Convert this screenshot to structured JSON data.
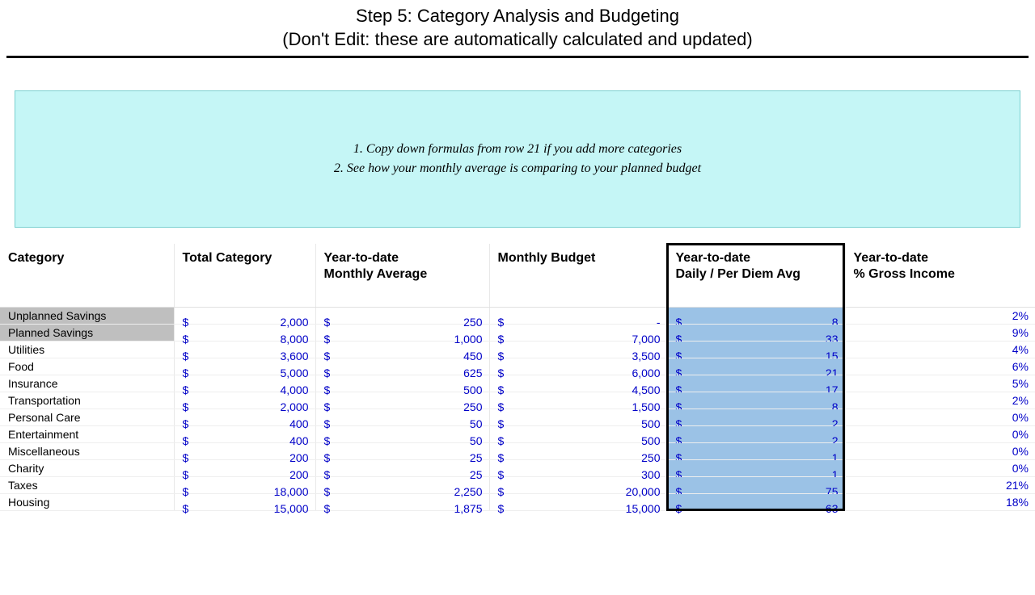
{
  "title": {
    "line1": "Step 5: Category Analysis and Budgeting",
    "line2": "(Don't Edit: these are automatically calculated and updated)"
  },
  "notes": {
    "line1": "1. Copy down formulas from row 21 if you add more categories",
    "line2": "2. See how your monthly average is comparing to your planned budget"
  },
  "headers": {
    "category": "Category",
    "total": "Total Category",
    "monthly_avg": "Year-to-date Monthly Average",
    "budget": "Monthly Budget",
    "daily": "Year-to-date Daily / Per Diem Avg",
    "pct": "Year-to-date % Gross Income"
  },
  "rows": [
    {
      "cat": "Unplanned Savings",
      "shaded": true,
      "total": "2,000",
      "avg": "250",
      "budget": "-",
      "daily": "8",
      "pct": "2%"
    },
    {
      "cat": "Planned Savings",
      "shaded": true,
      "total": "8,000",
      "avg": "1,000",
      "budget": "7,000",
      "daily": "33",
      "pct": "9%"
    },
    {
      "cat": "Utilities",
      "shaded": false,
      "total": "3,600",
      "avg": "450",
      "budget": "3,500",
      "daily": "15",
      "pct": "4%"
    },
    {
      "cat": "Food",
      "shaded": false,
      "total": "5,000",
      "avg": "625",
      "budget": "6,000",
      "daily": "21",
      "pct": "6%"
    },
    {
      "cat": "Insurance",
      "shaded": false,
      "total": "4,000",
      "avg": "500",
      "budget": "4,500",
      "daily": "17",
      "pct": "5%"
    },
    {
      "cat": "Transportation",
      "shaded": false,
      "total": "2,000",
      "avg": "250",
      "budget": "1,500",
      "daily": "8",
      "pct": "2%"
    },
    {
      "cat": "Personal Care",
      "shaded": false,
      "total": "400",
      "avg": "50",
      "budget": "500",
      "daily": "2",
      "pct": "0%"
    },
    {
      "cat": "Entertainment",
      "shaded": false,
      "total": "400",
      "avg": "50",
      "budget": "500",
      "daily": "2",
      "pct": "0%"
    },
    {
      "cat": "Miscellaneous",
      "shaded": false,
      "total": "200",
      "avg": "25",
      "budget": "250",
      "daily": "1",
      "pct": "0%"
    },
    {
      "cat": "Charity",
      "shaded": false,
      "total": "200",
      "avg": "25",
      "budget": "300",
      "daily": "1",
      "pct": "0%"
    },
    {
      "cat": "Taxes",
      "shaded": false,
      "total": "18,000",
      "avg": "2,250",
      "budget": "20,000",
      "daily": "75",
      "pct": "21%"
    },
    {
      "cat": "Housing",
      "shaded": false,
      "total": "15,000",
      "avg": "1,875",
      "budget": "15,000",
      "daily": "63",
      "pct": "18%"
    }
  ]
}
